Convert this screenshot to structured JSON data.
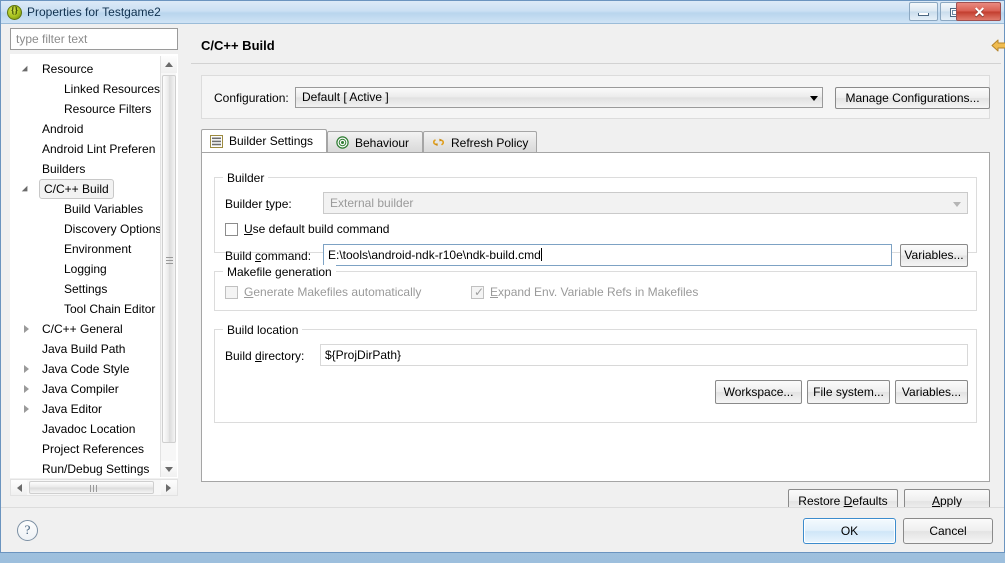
{
  "window": {
    "title": "Properties for Testgame2",
    "icon": "eclipse-properties-icon",
    "minimize_label": "",
    "maximize_label": "",
    "close_label": "✕"
  },
  "sidebar": {
    "filter_placeholder": "type filter text",
    "filter_value": "",
    "items": [
      {
        "label": "Resource",
        "depth": 0,
        "twisty": "open"
      },
      {
        "label": "Linked Resources",
        "depth": 1,
        "twisty": "none"
      },
      {
        "label": "Resource Filters",
        "depth": 1,
        "twisty": "none"
      },
      {
        "label": "Android",
        "depth": 0,
        "twisty": "none"
      },
      {
        "label": "Android Lint Preferen",
        "depth": 0,
        "twisty": "none"
      },
      {
        "label": "Builders",
        "depth": 0,
        "twisty": "none"
      },
      {
        "label": "C/C++ Build",
        "depth": 0,
        "twisty": "open",
        "selected": true
      },
      {
        "label": "Build Variables",
        "depth": 1,
        "twisty": "none"
      },
      {
        "label": "Discovery Options",
        "depth": 1,
        "twisty": "none"
      },
      {
        "label": "Environment",
        "depth": 1,
        "twisty": "none"
      },
      {
        "label": "Logging",
        "depth": 1,
        "twisty": "none"
      },
      {
        "label": "Settings",
        "depth": 1,
        "twisty": "none"
      },
      {
        "label": "Tool Chain Editor",
        "depth": 1,
        "twisty": "none"
      },
      {
        "label": "C/C++ General",
        "depth": 0,
        "twisty": "closed"
      },
      {
        "label": "Java Build Path",
        "depth": 0,
        "twisty": "none"
      },
      {
        "label": "Java Code Style",
        "depth": 0,
        "twisty": "closed"
      },
      {
        "label": "Java Compiler",
        "depth": 0,
        "twisty": "closed"
      },
      {
        "label": "Java Editor",
        "depth": 0,
        "twisty": "closed"
      },
      {
        "label": "Javadoc Location",
        "depth": 0,
        "twisty": "none"
      },
      {
        "label": "Project References",
        "depth": 0,
        "twisty": "none"
      },
      {
        "label": "Run/Debug Settings",
        "depth": 0,
        "twisty": "none"
      }
    ]
  },
  "header": {
    "title": "C/C++ Build",
    "back_icon": "back-arrow-icon",
    "back_menu_icon": "chevron-down-icon",
    "forward_icon": "forward-arrow-icon",
    "forward_menu_icon": "chevron-down-icon",
    "view_menu_icon": "chevron-down-icon"
  },
  "configuration": {
    "label": "Configuration:",
    "value": "Default  [ Active ]",
    "manage_label": "Manage Configurations..."
  },
  "tabs": [
    {
      "label": "Builder Settings",
      "icon": "list-icon",
      "active": true
    },
    {
      "label": "Behaviour",
      "icon": "target-icon",
      "active": false
    },
    {
      "label": "Refresh Policy",
      "icon": "refresh-icon",
      "active": false
    }
  ],
  "builder_group": {
    "title": "Builder",
    "builder_type_label": "Builder type:",
    "builder_type_label_mnemonic": "t",
    "builder_type_value": "External builder",
    "use_default_label": "Use default build command",
    "use_default_checked": false,
    "build_command_label": "Build command:",
    "build_command_value": "E:\\tools\\android-ndk-r10e\\ndk-build.cmd",
    "variables_label": "Variables..."
  },
  "makefile_group": {
    "title": "Makefile generation",
    "generate_label": "Generate Makefiles automatically",
    "generate_checked": false,
    "generate_enabled": false,
    "expand_label": "Expand Env. Variable Refs in Makefiles",
    "expand_checked": true,
    "expand_enabled": false
  },
  "build_location_group": {
    "title": "Build location",
    "directory_label": "Build directory:",
    "directory_value": "${ProjDirPath}",
    "workspace_label": "Workspace...",
    "filesystem_label": "File system...",
    "variables_label": "Variables..."
  },
  "page_buttons": {
    "restore_defaults_label": "Restore Defaults",
    "apply_label": "Apply"
  },
  "footer": {
    "help_icon": "help-icon",
    "help_glyph": "?",
    "ok_label": "OK",
    "cancel_label": "Cancel"
  },
  "colors": {
    "accent": "#3c8ccd",
    "title_text": "#10314f",
    "back_arrow": "#e0a83c",
    "forward_arrow": "#cfcfcf",
    "view_caret": "#2b2b66",
    "disabled_text": "#9a9a9a"
  }
}
